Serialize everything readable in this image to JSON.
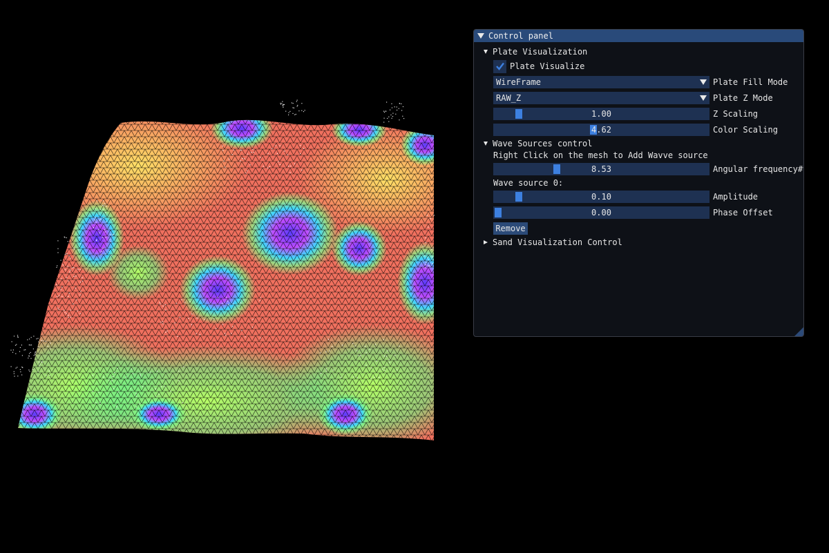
{
  "window": {
    "title": "Control panel"
  },
  "plate": {
    "header": "Plate Visualization",
    "visualize_label": "Plate Visualize",
    "visualize_checked": true,
    "fill_mode_value": "WireFrame",
    "fill_mode_label": "Plate Fill Mode",
    "z_mode_value": "RAW_Z",
    "z_mode_label": "Plate Z Mode",
    "z_scaling_value": "1.00",
    "z_scaling_label": "Z Scaling",
    "color_scaling_value": "4.62",
    "color_scaling_label": "Color Scaling"
  },
  "wave": {
    "header": "Wave Sources control",
    "hint": "Right Click on the mesh to Add Wavve source",
    "angular_value": "8.53",
    "angular_label": "Angular frequency#v",
    "source_header": "Wave source 0:",
    "amplitude_value": "0.10",
    "amplitude_label": "Amplitude",
    "phase_value": "0.00",
    "phase_label": "Phase Offset",
    "remove_label": "Remove"
  },
  "sand": {
    "header": "Sand Visualization Control"
  },
  "colors": {
    "accent": "#3d80e0",
    "frame_bg": "#1e3152",
    "title_bg": "#294a7a",
    "window_bg": "#0e1117"
  }
}
